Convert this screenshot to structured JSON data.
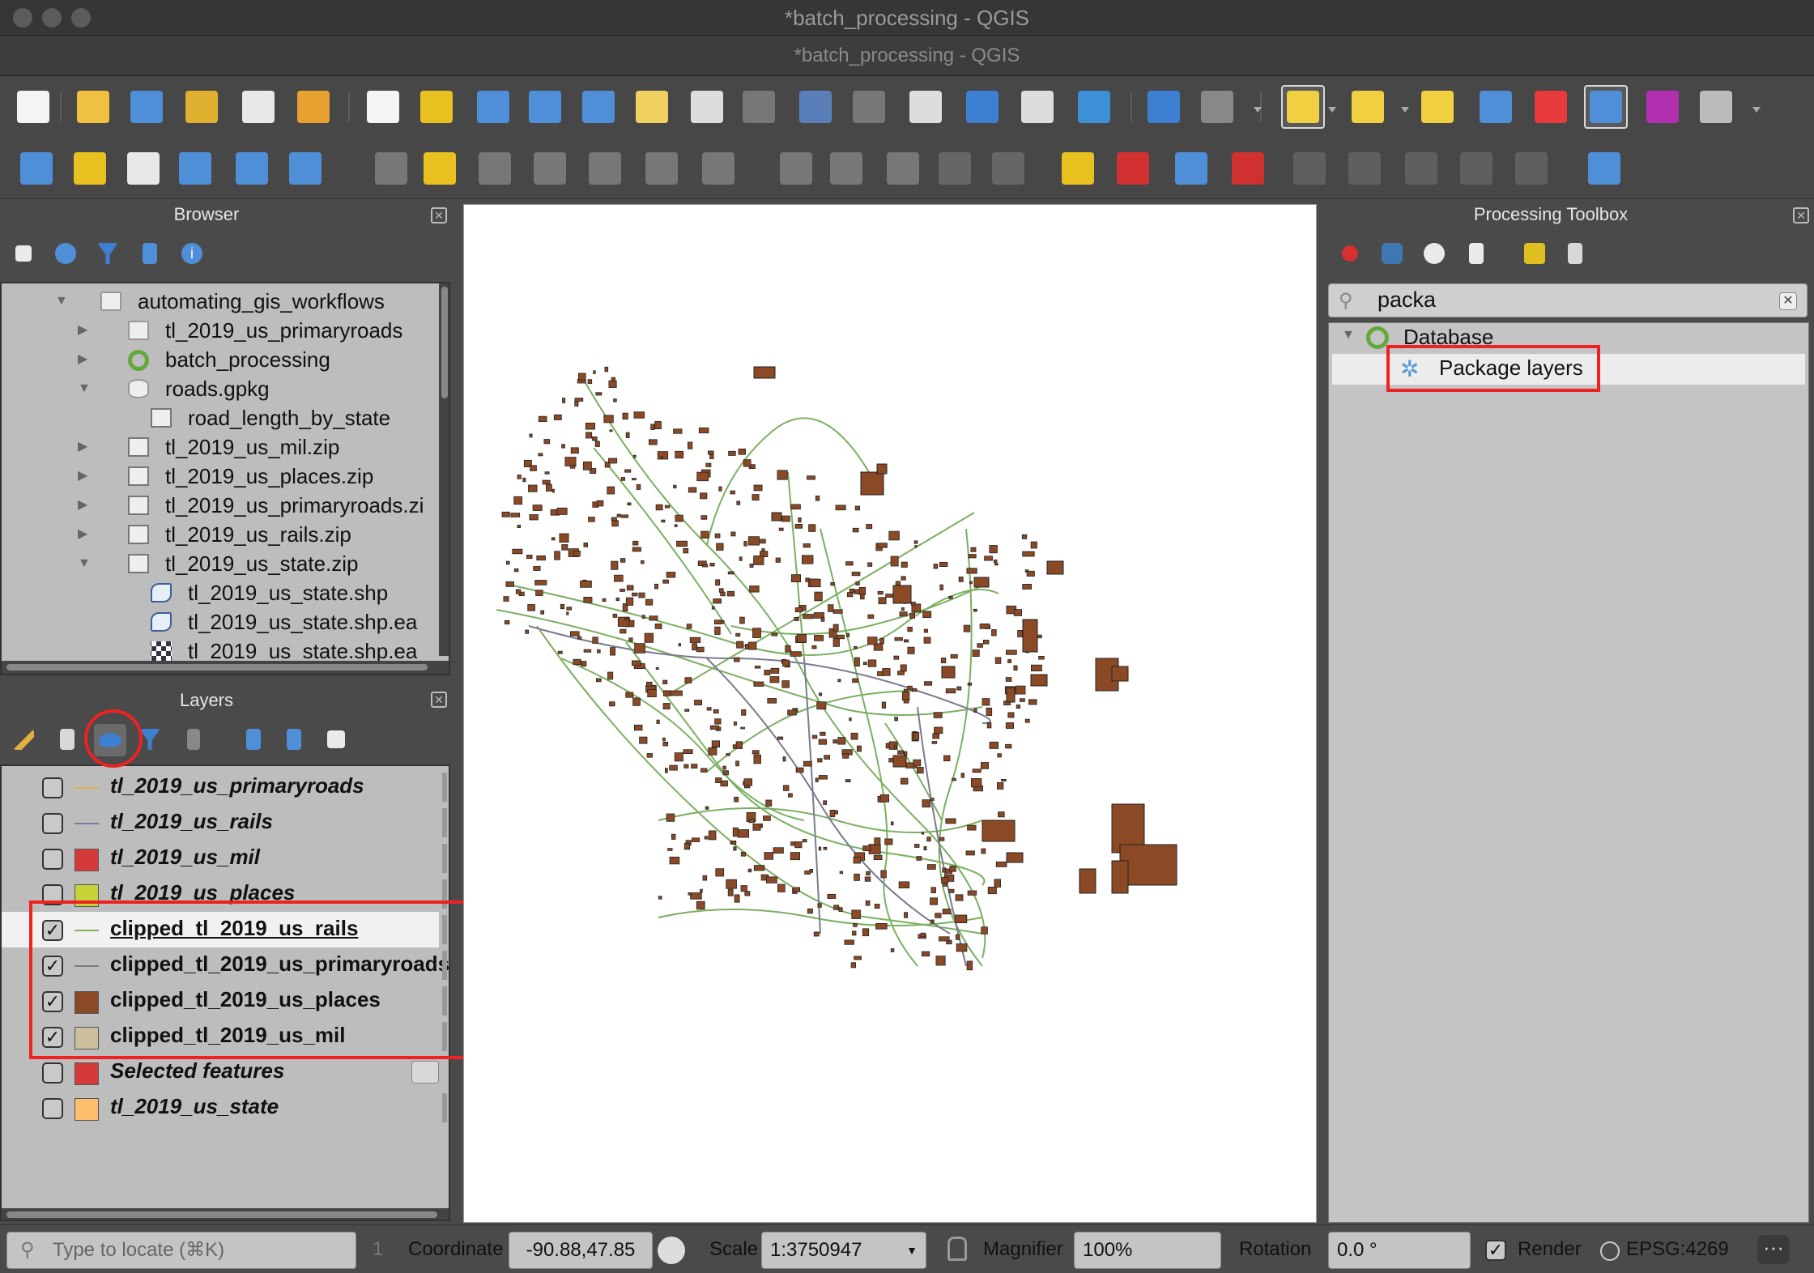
{
  "window": {
    "title": "*batch_processing - QGIS",
    "subtitle": "*batch_processing - QGIS"
  },
  "toolbar1_icons": [
    "new-project-icon",
    "open-project-icon",
    "save-project-icon",
    "new-print-layout-icon",
    "layout-manager-icon",
    "style-manager-icon",
    "pan-icon",
    "pan-to-selection-icon",
    "zoom-in-icon",
    "zoom-out-icon",
    "zoom-full-icon",
    "zoom-to-selection-icon",
    "zoom-to-layer-icon",
    "zoom-native-icon",
    "zoom-last-icon",
    "zoom-next-icon",
    "new-bookmark-icon",
    "show-bookmarks-icon",
    "new-spatial-bookmark-icon",
    "refresh-icon",
    "identify-icon",
    "run-action-icon",
    "select-features-icon",
    "select-by-expression-icon",
    "deselect-icon",
    "attribute-table-icon",
    "field-calculator-icon",
    "processing-toolbox-icon",
    "statistics-icon",
    "measure-icon"
  ],
  "toolbar2_icons": [
    "add-vector-layer-icon",
    "new-geopackage-layer-icon",
    "digitize-icon",
    "digitize-freehand-icon",
    "new-virtual-layer-icon",
    "vertex-tool-icon",
    "current-edits-icon",
    "toggle-editing-icon",
    "save-edits-icon",
    "add-feature-icon",
    "move-feature-icon",
    "node-tool-icon",
    "delete-selected-icon",
    "cut-features-icon",
    "copy-features-icon",
    "paste-features-icon",
    "undo-icon",
    "redo-icon",
    "label-icon",
    "diagram-icon",
    "pin-labels-icon",
    "show-hide-labels-icon",
    "label-disabled-1-icon",
    "label-disabled-2-icon",
    "label-disabled-3-icon",
    "label-disabled-4-icon",
    "label-disabled-5-icon",
    "help-icon"
  ],
  "browser": {
    "title": "Browser",
    "items": [
      {
        "label": "automating_gis_workflows",
        "icon": "folder-icon",
        "arrow": "▼"
      },
      {
        "label": "tl_2019_us_primaryroads",
        "icon": "folder-icon",
        "arrow": "▶"
      },
      {
        "label": "batch_processing",
        "icon": "qgis-project-icon",
        "arrow": "▶"
      },
      {
        "label": "roads.gpkg",
        "icon": "database-icon",
        "arrow": "▼"
      },
      {
        "label": "road_length_by_state",
        "icon": "table-icon",
        "arrow": ""
      },
      {
        "label": "tl_2019_us_mil.zip",
        "icon": "zip-icon",
        "arrow": "▶"
      },
      {
        "label": "tl_2019_us_places.zip",
        "icon": "zip-icon",
        "arrow": "▶"
      },
      {
        "label": "tl_2019_us_primaryroads.zi",
        "icon": "zip-icon",
        "arrow": "▶"
      },
      {
        "label": "tl_2019_us_rails.zip",
        "icon": "zip-icon",
        "arrow": "▶"
      },
      {
        "label": "tl_2019_us_state.zip",
        "icon": "zip-icon",
        "arrow": "▼"
      },
      {
        "label": "tl_2019_us_state.shp",
        "icon": "polygon-layer-icon",
        "arrow": ""
      },
      {
        "label": "tl_2019_us_state.shp.ea",
        "icon": "polygon-layer-icon",
        "arrow": ""
      },
      {
        "label": "tl_2019_us_state.shp.ea",
        "icon": "raster-layer-icon",
        "arrow": ""
      }
    ]
  },
  "layers": {
    "title": "Layers",
    "items": [
      {
        "label": "tl_2019_us_primaryroads",
        "checked": false,
        "symbol": "line",
        "color": "#e0b050",
        "italic": true
      },
      {
        "label": "tl_2019_us_rails",
        "checked": false,
        "symbol": "line",
        "color": "#7a7aa0",
        "italic": true
      },
      {
        "label": "tl_2019_us_mil",
        "checked": false,
        "symbol": "fill",
        "color": "#d53a3a",
        "italic": true
      },
      {
        "label": "tl_2019_us_places",
        "checked": false,
        "symbol": "fill",
        "color": "#c5d238",
        "italic": true
      },
      {
        "label": "clipped_tl_2019_us_rails",
        "checked": true,
        "symbol": "line",
        "color": "#7ab060",
        "italic": false
      },
      {
        "label": "clipped_tl_2019_us_primaryroads",
        "checked": true,
        "symbol": "line",
        "color": "#7a7a80",
        "italic": false
      },
      {
        "label": "clipped_tl_2019_us_places",
        "checked": true,
        "symbol": "fill",
        "color": "#8b4a25",
        "italic": false
      },
      {
        "label": "clipped_tl_2019_us_mil",
        "checked": true,
        "symbol": "fill",
        "color": "#cbbf9e",
        "italic": false
      },
      {
        "label": "Selected features",
        "checked": false,
        "symbol": "fill",
        "color": "#d53a3a",
        "italic": true
      },
      {
        "label": "tl_2019_us_state",
        "checked": false,
        "symbol": "fill",
        "color": "#ffbe6e",
        "italic": true
      }
    ]
  },
  "processing": {
    "title": "Processing Toolbox",
    "search_value": "packa",
    "group": "Database",
    "algorithm": "Package layers"
  },
  "status": {
    "locator_placeholder": "Type to locate (⌘K)",
    "coordinate_label": "Coordinate",
    "coordinate_value": "-90.88,47.85",
    "scale_label": "Scale",
    "scale_value": "1:3750947",
    "magnifier_label": "Magnifier",
    "magnifier_value": "100%",
    "rotation_label": "Rotation",
    "rotation_value": "0.0 °",
    "render_label": "Render",
    "crs": "EPSG:4269",
    "messages_count": "1"
  },
  "colors": {
    "places": "#8b4a25",
    "rails": "#7ab060",
    "roads": "#7a7a90",
    "highlight": "#ee2222"
  }
}
